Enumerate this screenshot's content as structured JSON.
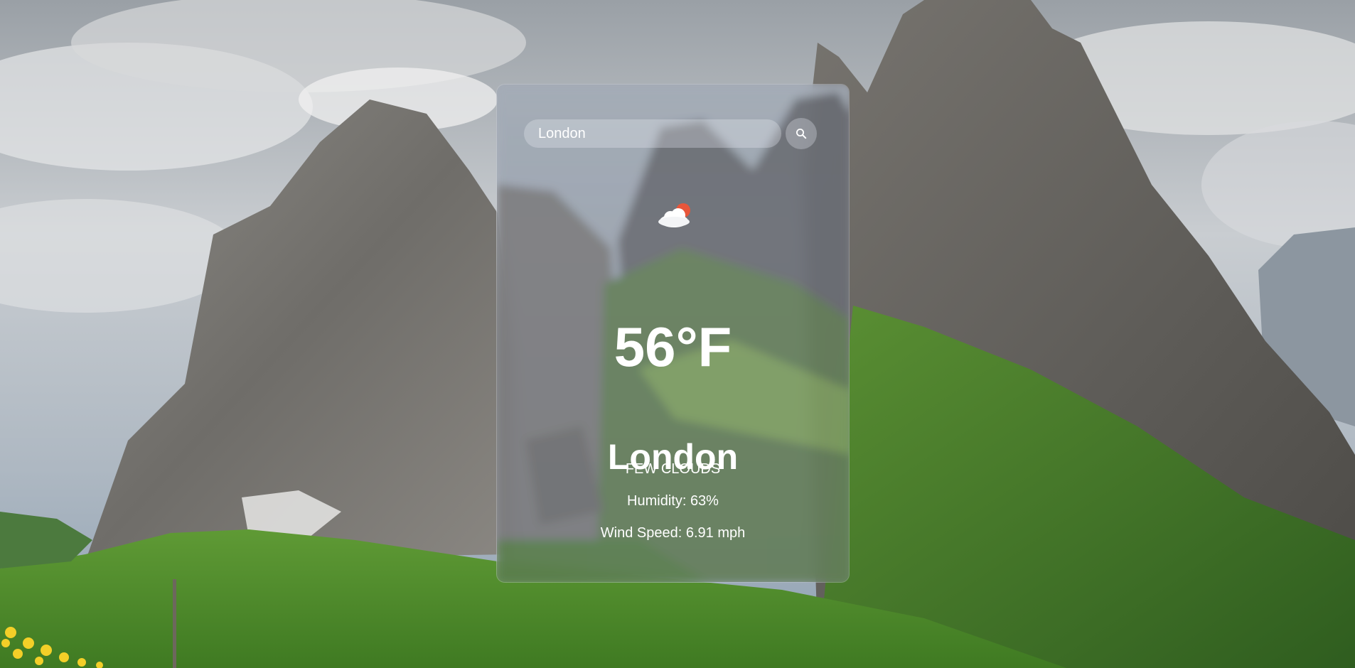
{
  "search": {
    "value": "London",
    "button_icon": "search-icon"
  },
  "weather": {
    "icon": "partly-cloudy-icon",
    "temperature": "56°F",
    "city": "London",
    "description": "FEW CLOUDS",
    "humidity": "Humidity: 63%",
    "wind": "Wind Speed: 6.91 mph"
  },
  "colors": {
    "text": "#ffffff",
    "sun": "#e8563a",
    "cloud": "#ffffff"
  }
}
